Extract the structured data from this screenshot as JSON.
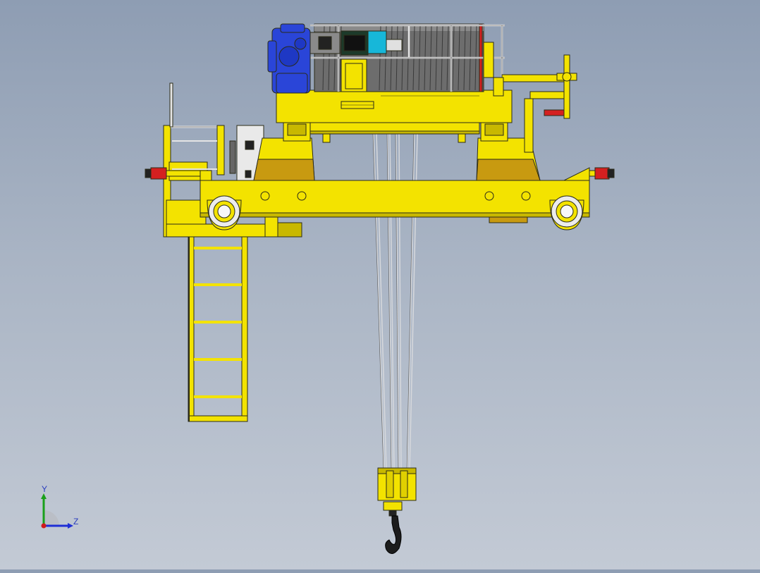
{
  "triad": {
    "y_label": "Y",
    "z_label": "Z",
    "colors": {
      "y": "#1aa01a",
      "z": "#1f2fd6",
      "x": "#d01b1b"
    }
  },
  "colors": {
    "background_top": "#8e9db3",
    "background_bottom": "#c3cad5",
    "structure": "#f3e300",
    "structure_shadow": "#c8b800",
    "outline": "#2b2b18",
    "motor_blue": "#2a45d8",
    "motor_cyan": "#17b7d9",
    "drum": "#6d6d6d",
    "ochre": "#c89a10",
    "buffer_red": "#d42020",
    "cabinet": "#e9e9e9",
    "rope": "#d6d8dc",
    "hook": "#1c1c1c"
  }
}
